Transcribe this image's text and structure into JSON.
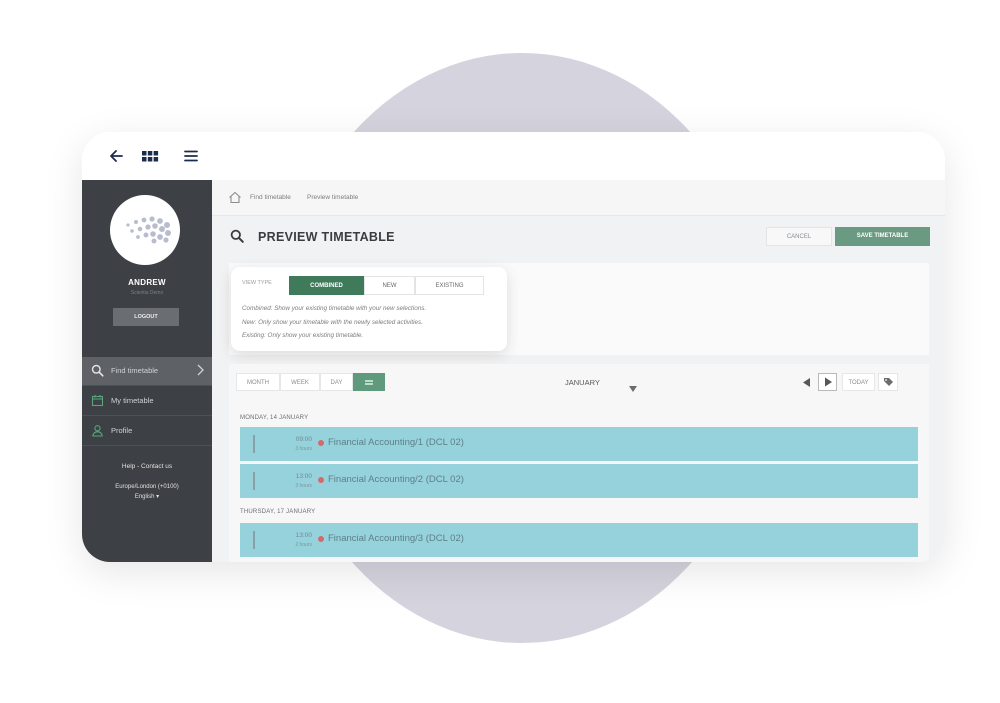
{
  "topbar": {
    "back_icon": "arrow-left-icon",
    "grid_icon": "grid-icon",
    "menu_icon": "hamburger-icon"
  },
  "sidebar": {
    "user_name": "ANDREW",
    "user_subtitle": "Scientia Demo",
    "logout_label": "LOGOUT",
    "items": [
      {
        "label": "Find timetable",
        "icon": "search-icon",
        "active": true
      },
      {
        "label": "My timetable",
        "icon": "calendar-icon",
        "active": false
      },
      {
        "label": "Profile",
        "icon": "user-icon",
        "active": false
      }
    ],
    "help": "Help - Contact us",
    "timezone": "Europe/London (+0100)",
    "language": "English ▾"
  },
  "breadcrumb": [
    "Find timetable",
    "Preview timetable"
  ],
  "page": {
    "title": "PREVIEW TIMETABLE",
    "cancel_label": "CANCEL",
    "save_label": "SAVE TIMETABLE"
  },
  "view_type": {
    "label": "VIEW TYPE",
    "options": [
      "COMBINED",
      "NEW",
      "EXISTING"
    ],
    "selected": "COMBINED",
    "descriptions": [
      "Combined: Show your existing timetable with your new selections.",
      "New: Only show your timetable with the newly selected activities.",
      "Existing: Only show your existing timetable."
    ]
  },
  "calendar": {
    "tabs": [
      "MONTH",
      "WEEK",
      "DAY"
    ],
    "list_icon": "list-icon",
    "month": "JANUARY",
    "today_label": "TODAY",
    "days": [
      {
        "header": "MONDAY, 14 JANUARY",
        "events": [
          {
            "time": "09:00",
            "duration": "3 hours",
            "name": "Financial Accounting/1 (DCL 02)"
          },
          {
            "time": "13:00",
            "duration": "3 hours",
            "name": "Financial Accounting/2 (DCL 02)"
          }
        ]
      },
      {
        "header": "THURSDAY, 17 JANUARY",
        "events": [
          {
            "time": "13:00",
            "duration": "2 hours",
            "name": "Financial Accounting/3 (DCL 02)"
          }
        ]
      }
    ]
  },
  "colors": {
    "accent": "#3f7a5b",
    "event": "#96d2dc",
    "sidebar": "#3d4044",
    "backdrop": "#d5d4de"
  }
}
